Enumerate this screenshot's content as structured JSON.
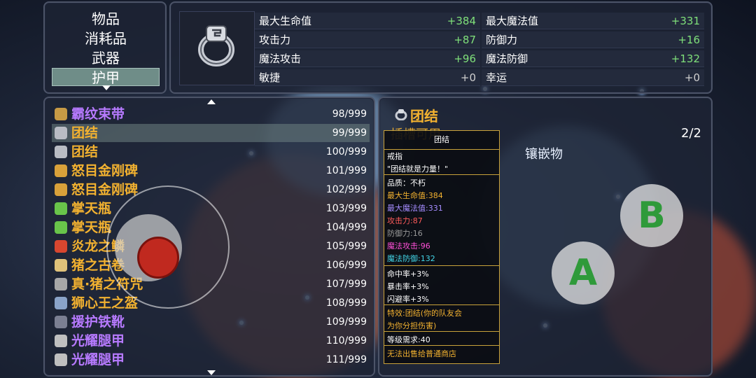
{
  "categories": [
    "物品",
    "消耗品",
    "武器",
    "护甲"
  ],
  "selected_category": "护甲",
  "stats": [
    {
      "label": "最大生命值",
      "value": "+384"
    },
    {
      "label": "最大魔法值",
      "value": "+331"
    },
    {
      "label": "攻击力",
      "value": "+87"
    },
    {
      "label": "防御力",
      "value": "+16"
    },
    {
      "label": "魔法攻击",
      "value": "+96"
    },
    {
      "label": "魔法防御",
      "value": "+132"
    },
    {
      "label": "敏捷",
      "value": "+0"
    },
    {
      "label": "幸运",
      "value": "+0"
    }
  ],
  "items": [
    {
      "name": "霸纹束带",
      "count": "98/999",
      "color": "purple",
      "icon": "belt-icon",
      "icon_color": "#c79a45"
    },
    {
      "name": "团结",
      "count": "99/999",
      "color": "orange",
      "icon": "ring-icon",
      "icon_color": "#b9bcc4",
      "selected": true
    },
    {
      "name": "团结",
      "count": "100/999",
      "color": "orange",
      "icon": "ring-icon",
      "icon_color": "#b9bcc4"
    },
    {
      "name": "怒目金刚碑",
      "count": "101/999",
      "color": "orange",
      "icon": "tablet-icon",
      "icon_color": "#d9a13a"
    },
    {
      "name": "怒目金刚碑",
      "count": "102/999",
      "color": "orange",
      "icon": "tablet-icon",
      "icon_color": "#d9a13a"
    },
    {
      "name": "掌天瓶",
      "count": "103/999",
      "color": "orange",
      "icon": "bottle-icon",
      "icon_color": "#69c44a"
    },
    {
      "name": "掌天瓶",
      "count": "104/999",
      "color": "orange",
      "icon": "bottle-icon",
      "icon_color": "#69c44a"
    },
    {
      "name": "炎龙之鳞",
      "count": "105/999",
      "color": "orange",
      "icon": "scale-icon",
      "icon_color": "#d8462f"
    },
    {
      "name": "猪之古卷",
      "count": "106/999",
      "color": "orange",
      "icon": "scroll-icon",
      "icon_color": "#e0c27a"
    },
    {
      "name": "真·猪之符咒",
      "count": "107/999",
      "color": "orange",
      "icon": "charm-icon",
      "icon_color": "#a7a7a7"
    },
    {
      "name": "狮心王之盔",
      "count": "108/999",
      "color": "orange",
      "icon": "helmet-icon",
      "icon_color": "#8aa3c8"
    },
    {
      "name": "援护铁靴",
      "count": "109/999",
      "color": "purple",
      "icon": "boots-icon",
      "icon_color": "#7b7f92"
    },
    {
      "name": "光耀腿甲",
      "count": "110/999",
      "color": "purple",
      "icon": "greaves-icon",
      "icon_color": "#bfbfbf"
    },
    {
      "name": "光耀腿甲",
      "count": "111/999",
      "color": "purple",
      "icon": "greaves-icon",
      "icon_color": "#bfbfbf"
    }
  ],
  "detail": {
    "title": "团结",
    "slot_label": "插槽可用",
    "slot_count": "2/2",
    "inlay_label": "镶嵌物"
  },
  "tooltip": {
    "title": "团结",
    "lines": [
      {
        "text": "戒指",
        "color": "#ffffff"
      },
      {
        "text": "\"团结就是力量！\"",
        "color": "#ffffff"
      },
      {
        "text": "品质：不朽",
        "color": "#ffffff"
      },
      {
        "text": "最大生命值:384",
        "color": "#f3b230"
      },
      {
        "text": "最大魔法值:331",
        "color": "#a58cff"
      },
      {
        "text": "攻击力:87",
        "color": "#ff5b5b"
      },
      {
        "text": "防御力:16",
        "color": "#9a9a9a"
      },
      {
        "text": "魔法攻击:96",
        "color": "#ff4fd8"
      },
      {
        "text": "魔法防御:132",
        "color": "#43d6e8"
      },
      {
        "text": "命中率+3%",
        "color": "#ffffff"
      },
      {
        "text": "暴击率+3%",
        "color": "#ffffff"
      },
      {
        "text": "闪避率+3%",
        "color": "#ffffff"
      },
      {
        "text": "特效:团结(你的队友会",
        "color": "#f3b230"
      },
      {
        "text": "为你分担伤害)",
        "color": "#f3b230"
      },
      {
        "text": "等级需求:40",
        "color": "#ffffff"
      },
      {
        "text": "无法出售给普通商店",
        "color": "#f3b230"
      }
    ]
  },
  "controls": {
    "button_b": "B",
    "button_a": "A"
  },
  "colors": {
    "orange": "#f3b230",
    "purple": "#b77aff",
    "stat_value": "#7fe07a",
    "selected_bg": "#6f8d88"
  }
}
